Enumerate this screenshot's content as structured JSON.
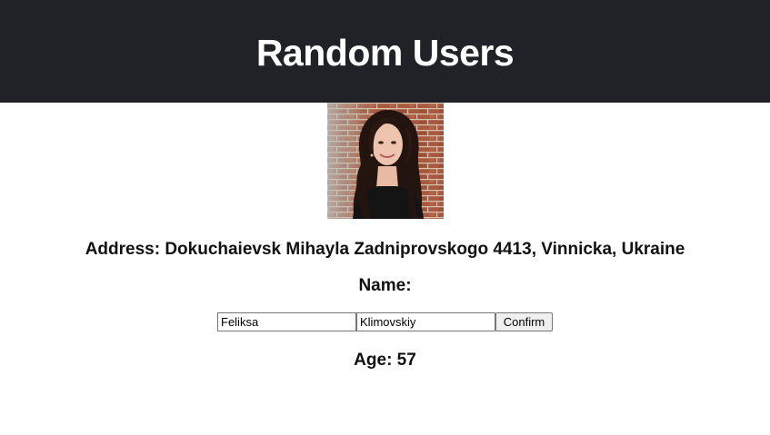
{
  "header": {
    "title": "Random Users",
    "background_color": "#202227"
  },
  "user": {
    "photo_alt": "user-photo",
    "address_label": "Address: Dokuchaievsk Mihayla Zadniprovskogo 4413, Vinnicka, Ukraine",
    "name_label": "Name:",
    "first_name": "Feliksa",
    "last_name": "Klimovskiy",
    "confirm_label": "Confirm",
    "age_label": "Age: 57"
  }
}
